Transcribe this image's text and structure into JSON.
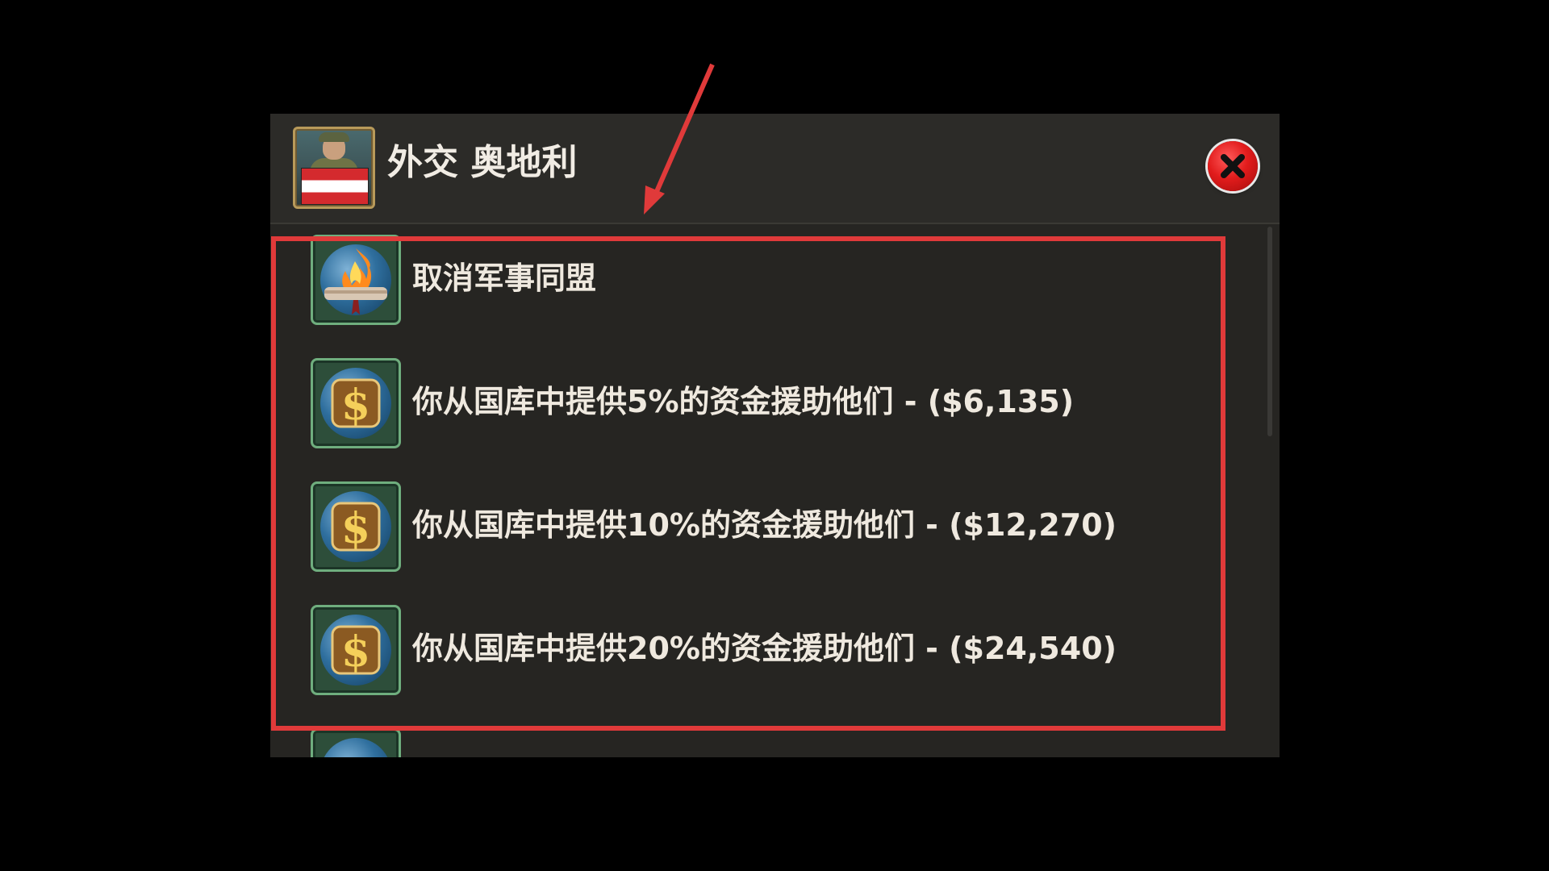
{
  "dialog": {
    "title": "外交 奥地利",
    "leader_icon": "leader-portrait",
    "flag_colors": [
      "#d42a2e",
      "#ffffff",
      "#d42a2e"
    ],
    "close_icon": "close-icon"
  },
  "actions": [
    {
      "icon": "burning-treaty-icon",
      "label": "取消军事同盟"
    },
    {
      "icon": "dollar-icon",
      "label": "你从国库中提供5%的资金援助他们 - ($6,135)"
    },
    {
      "icon": "dollar-icon",
      "label": "你从国库中提供10%的资金援助他们 - ($12,270)"
    },
    {
      "icon": "dollar-icon",
      "label": "你从国库中提供20%的资金援助他们 - ($24,540)"
    },
    {
      "icon": "dollar-icon",
      "label": ""
    }
  ],
  "annotation": {
    "color": "#e03a3a"
  }
}
